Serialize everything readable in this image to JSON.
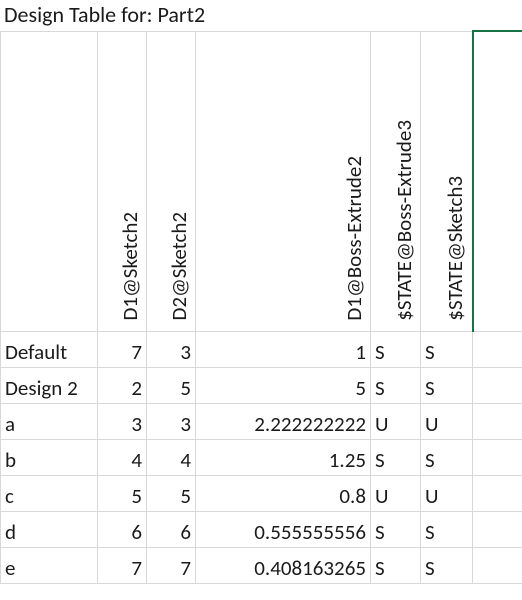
{
  "title": "Design Table for: Part2",
  "columns": [
    "D1@Sketch2",
    "D2@Sketch2",
    "D1@Boss-Extrude2",
    "$STATE@Boss-Extrude3",
    "$STATE@Sketch3"
  ],
  "rows": [
    {
      "name": "Default",
      "d1s2": "7",
      "d2s2": "3",
      "d1be2": "1",
      "st_be3": "S",
      "st_sk3": "S"
    },
    {
      "name": "Design 2",
      "d1s2": "2",
      "d2s2": "5",
      "d1be2": "5",
      "st_be3": "S",
      "st_sk3": "S"
    },
    {
      "name": "a",
      "d1s2": "3",
      "d2s2": "3",
      "d1be2": "2.222222222",
      "st_be3": "U",
      "st_sk3": "U"
    },
    {
      "name": "b",
      "d1s2": "4",
      "d2s2": "4",
      "d1be2": "1.25",
      "st_be3": "S",
      "st_sk3": "S"
    },
    {
      "name": "c",
      "d1s2": "5",
      "d2s2": "5",
      "d1be2": "0.8",
      "st_be3": "U",
      "st_sk3": "U"
    },
    {
      "name": "d",
      "d1s2": "6",
      "d2s2": "6",
      "d1be2": "0.555555556",
      "st_be3": "S",
      "st_sk3": "S"
    },
    {
      "name": "e",
      "d1s2": "7",
      "d2s2": "7",
      "d1be2": "0.408163265",
      "st_be3": "S",
      "st_sk3": "S"
    }
  ]
}
